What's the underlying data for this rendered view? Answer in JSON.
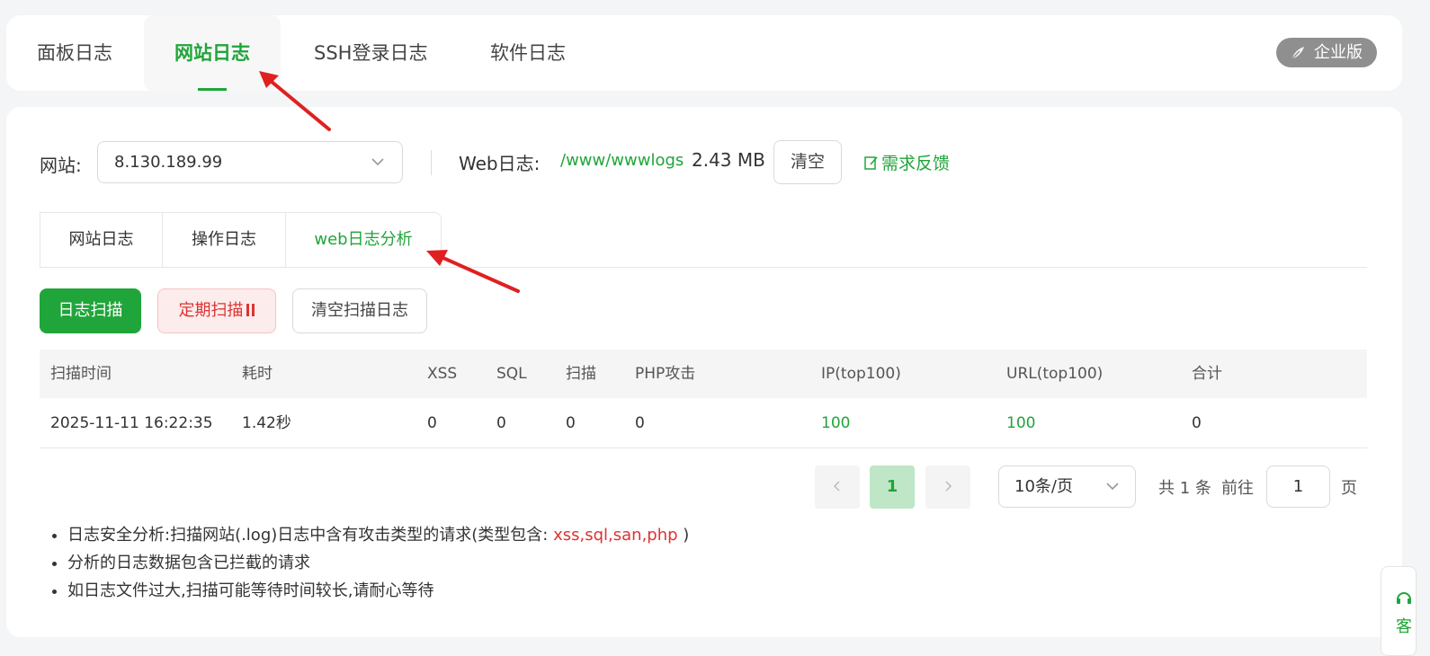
{
  "top_tabs": [
    {
      "label": "面板日志"
    },
    {
      "label": "网站日志",
      "active": true
    },
    {
      "label": "SSH登录日志"
    },
    {
      "label": "软件日志"
    }
  ],
  "enterprise_label": "企业版",
  "site": {
    "label": "网站:",
    "selected": "8.130.189.99"
  },
  "web_log": {
    "label": "Web日志:",
    "path": "/www/wwwlogs",
    "size": "2.43 MB",
    "clear_label": "清空",
    "feedback_label": "需求反馈"
  },
  "sub_tabs": [
    {
      "label": "网站日志"
    },
    {
      "label": "操作日志"
    },
    {
      "label": "web日志分析",
      "active": true
    }
  ],
  "actions": {
    "scan": "日志扫描",
    "periodic": "定期扫描",
    "clear_scan": "清空扫描日志"
  },
  "table": {
    "headers": [
      "扫描时间",
      "耗时",
      "XSS",
      "SQL",
      "扫描",
      "PHP攻击",
      "IP(top100)",
      "URL(top100)",
      "合计"
    ],
    "rows": [
      [
        "2025-11-11 16:22:35",
        "1.42秒",
        "0",
        "0",
        "0",
        "0",
        "100",
        "100",
        "0"
      ]
    ]
  },
  "pagination": {
    "current": "1",
    "page_size": "10条/页",
    "total": "共 1 条",
    "goto_label": "前往",
    "goto_value": "1",
    "unit": "页"
  },
  "notes": {
    "line1_prefix": "日志安全分析:扫描网站(.log)日志中含有攻击类型的请求(类型包含:",
    "line1_types": "xss,sql,san,php",
    "line1_suffix": ")",
    "line2": "分析的日志数据包含已拦截的请求",
    "line3": "如日志文件过大,扫描可能等待时间较长,请耐心等待"
  },
  "service_label": "客",
  "colors": {
    "accent": "#20a53a",
    "danger": "#dd3333",
    "annotation_arrow": "#e02020"
  },
  "icons": [
    "enterprise-leaf-icon",
    "chevron-down-icon",
    "edit-note-icon",
    "pause-icon",
    "chevron-left-icon",
    "chevron-right-icon",
    "headset-icon"
  ]
}
